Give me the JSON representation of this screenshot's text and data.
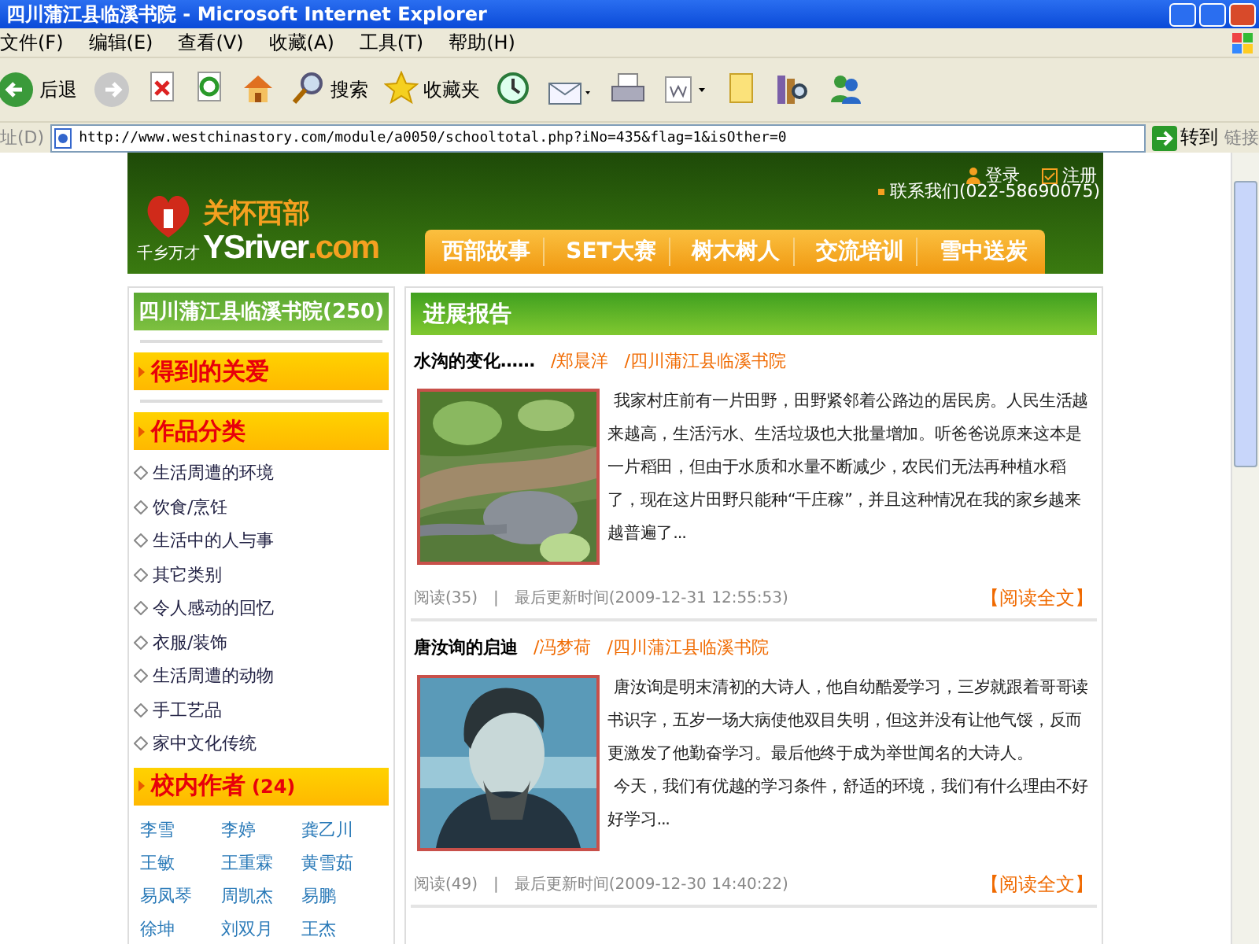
{
  "window": {
    "title": "四川蒲江县临溪书院 - Microsoft Internet Explorer"
  },
  "menu": [
    "文件(F)",
    "编辑(E)",
    "查看(V)",
    "收藏(A)",
    "工具(T)",
    "帮助(H)"
  ],
  "toolbar": [
    {
      "kind": "back",
      "label": "后退"
    },
    {
      "kind": "forward"
    },
    {
      "kind": "stop"
    },
    {
      "kind": "refresh"
    },
    {
      "kind": "home"
    },
    {
      "kind": "search",
      "label": "搜索"
    },
    {
      "kind": "favorites",
      "label": "收藏夹"
    },
    {
      "kind": "history"
    },
    {
      "kind": "mail"
    },
    {
      "kind": "print"
    },
    {
      "kind": "edit"
    },
    {
      "kind": "note"
    },
    {
      "kind": "research"
    },
    {
      "kind": "messenger"
    }
  ],
  "address": {
    "label": "址(D)",
    "url": "http://www.westchinastory.com/module/a0050/schooltotal.php?iNo=435&flag=1&isOther=0",
    "go": "转到",
    "links": "链接"
  },
  "site": {
    "logo_cn": "关怀西部",
    "slogan": "千乡万才",
    "logo_en": "YSriver",
    "logo_tld": ".com",
    "login": "登录",
    "register": "注册",
    "contact": "联系我们(022-58690075)",
    "nav": [
      "西部故事",
      "SET大赛",
      "树木树人",
      "交流培训",
      "雪中送炭"
    ]
  },
  "sidebar": {
    "school": "四川蒲江县临溪书院(250)",
    "care": "得到的关爱",
    "categories_title": "作品分类",
    "categories": [
      "生活周遭的环境",
      "饮食/烹饪",
      "生活中的人与事",
      "其它类别",
      "令人感动的回忆",
      "衣服/装饰",
      "生活周遭的动物",
      "手工艺品",
      "家中文化传统"
    ],
    "authors_title": "校内作者",
    "authors_count": "(24)",
    "authors": [
      "李雪",
      "李婷",
      "龚乙川",
      "王敏",
      "王重霖",
      "黄雪茹",
      "易凤琴",
      "周凯杰",
      "易鹏",
      "徐坤",
      "刘双月",
      "王杰"
    ]
  },
  "section_title": "进展报告",
  "articles": [
    {
      "title": "水沟的变化……",
      "author": "/郑晨洋",
      "school": "/四川蒲江县临溪书院",
      "excerpt": [
        "我家村庄前有一片田野，田野紧邻着公路边的居民房。人民生活越来越高，生活污水、生活垃圾也大批量增加。听爸爸说原来这本是一片稻田，但由于水质和水量不断减少，农民们无法再种植水稻了，现在这片田野只能种“干庄稼”，并且这种情况在我的家乡越来越普遍了..."
      ],
      "reads": "阅读(35)",
      "separator": "|",
      "updated": "最后更新时间(2009-12-31 12:55:53)",
      "more": "【阅读全文】"
    },
    {
      "title": "唐汝询的启迪",
      "author": "/冯梦荷",
      "school": "/四川蒲江县临溪书院",
      "excerpt": [
        "唐汝询是明末清初的大诗人，他自幼酷爱学习，三岁就跟着哥哥读书识字，五岁一场大病使他双目失明，但这并没有让他气馁，反而更激发了他勤奋学习。最后他终于成为举世闻名的大诗人。",
        "今天，我们有优越的学习条件，舒适的环境，我们有什么理由不好好学习..."
      ],
      "reads": "阅读(49)",
      "separator": "|",
      "updated": "最后更新时间(2009-12-30 14:40:22)",
      "more": "【阅读全文】"
    }
  ]
}
